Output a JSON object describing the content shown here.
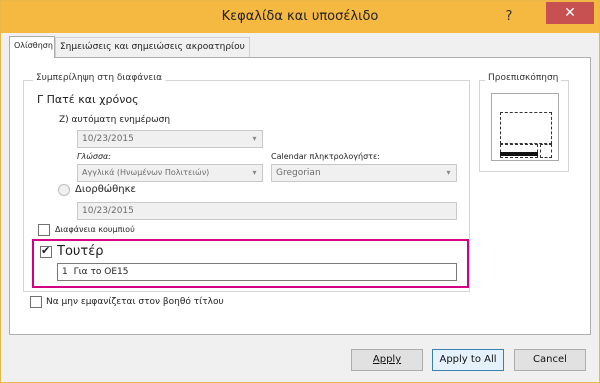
{
  "window": {
    "title": "Κεφαλίδα και υποσέλιδο",
    "help_glyph": "?",
    "close_glyph": "✕"
  },
  "tabs": [
    {
      "label": "Ολίσθηση"
    },
    {
      "label": "Σημειώσεις και σημειώσεις ακροατηρίου"
    }
  ],
  "include_group": {
    "legend": "Συμπερίληψη στη διαφάνεια",
    "datetime_label": "Γ Πατέ και χρόνος",
    "auto_update_label": "Ζ) αυτόματη ενημέρωση",
    "auto_update_value": "10/23/2015",
    "language_label": "Γλώσσα:",
    "language_value": "Αγγλικά (Ηνωμένων Πολιτειών)",
    "calendar_label": "Calendar πληκτρολογήστε:",
    "calendar_value": "Gregorian",
    "fixed_label": "Διορθώθηκε",
    "fixed_value": "10/23/2015",
    "slide_number_label": "Διαφάνεια κουμπιού",
    "footer_label": "Τουτέρ",
    "footer_checked": true,
    "footer_value": "Για το ΟΕ15",
    "footer_prefix": "1"
  },
  "preview": {
    "legend": "Προεπισκόπηση"
  },
  "dont_show_label": "Να μην εμφανίζεται στον βοηθό τίτλου",
  "buttons": {
    "apply": "Apply",
    "apply_all": "Apply to All",
    "cancel": "Cancel"
  },
  "colors": {
    "titlebar": "#f5b841",
    "close": "#c75050",
    "highlight": "#d40081"
  }
}
